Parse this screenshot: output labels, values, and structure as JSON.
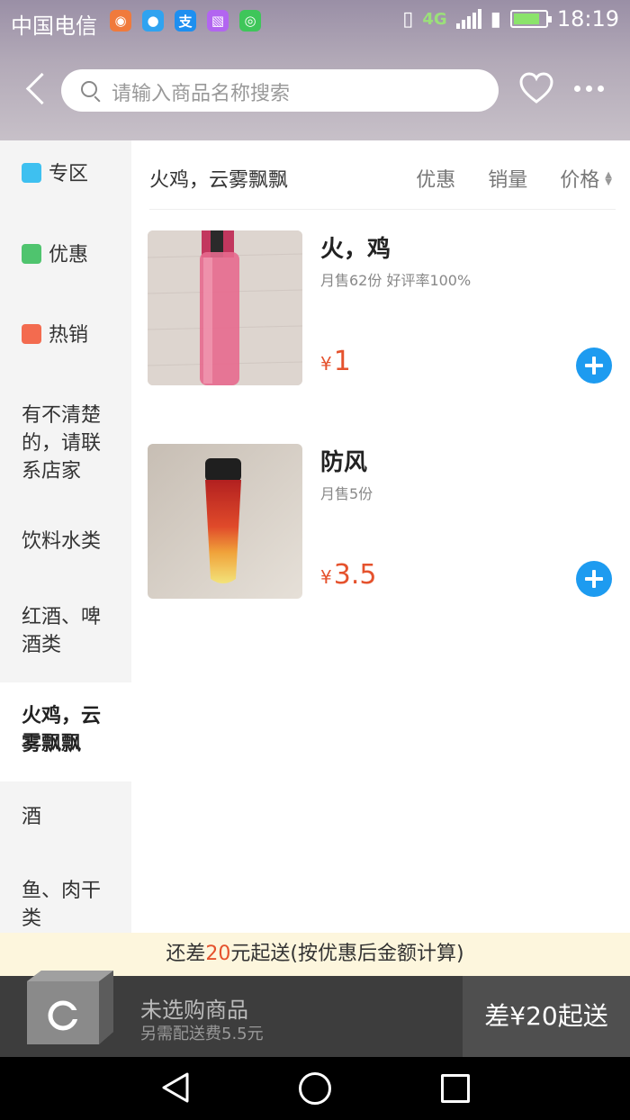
{
  "status_bar": {
    "carrier": "中国电信",
    "network": "4G",
    "time": "18:19"
  },
  "header": {
    "search_placeholder": "请输入商品名称搜索"
  },
  "sidebar": {
    "items": [
      {
        "label": "专区",
        "icon": "gift-icon",
        "color": "#3ec0f0"
      },
      {
        "label": "优惠",
        "icon": "discount-icon",
        "color": "#4fc46e"
      },
      {
        "label": "热销",
        "icon": "fire-icon",
        "color": "#f36b4f"
      },
      {
        "label": "有不清楚的，请联系店家"
      },
      {
        "label": "饮料水类"
      },
      {
        "label": "红酒、啤酒类"
      },
      {
        "label": "火鸡，云雾飘飘",
        "active": true
      },
      {
        "label": "酒"
      },
      {
        "label": "鱼、肉干类"
      }
    ]
  },
  "content": {
    "section_title": "火鸡，云雾飘飘",
    "sorts": [
      "优惠",
      "销量",
      "价格"
    ],
    "products": [
      {
        "name": "火，鸡",
        "meta": "月售62份 好评率100%",
        "currency": "¥",
        "price": "1"
      },
      {
        "name": "防风",
        "meta": "月售5份",
        "currency": "¥",
        "price": "3.5"
      }
    ]
  },
  "notice": {
    "prefix": "还差",
    "amount": "20",
    "suffix": "元起送(按优惠后金额计算)"
  },
  "cart": {
    "title": "未选购商品",
    "subtitle": "另需配送费5.5元",
    "checkout_label": "差¥20起送"
  },
  "colors": {
    "accent": "#1d9bf0",
    "price": "#e5522d"
  }
}
